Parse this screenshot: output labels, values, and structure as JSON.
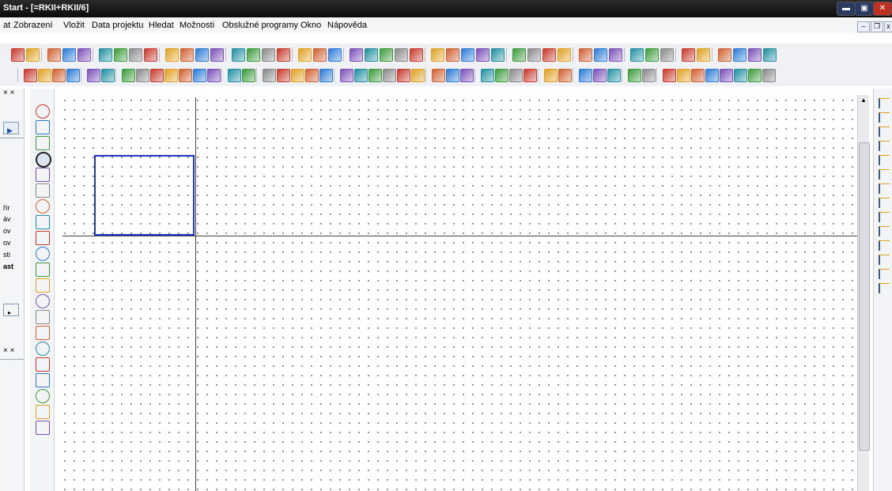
{
  "window": {
    "title": "Start - [=RKII+RKII/6]",
    "controls": [
      "minimize",
      "maximize",
      "close"
    ]
  },
  "menu": {
    "items": [
      {
        "label": "at"
      },
      {
        "label": "Zobrazení"
      },
      {
        "label": "Vložit"
      },
      {
        "label": "Data projektu"
      },
      {
        "label": "Hledat"
      },
      {
        "label": "Možnosti"
      },
      {
        "label": "Obslužné programy"
      },
      {
        "label": "Okno"
      },
      {
        "label": "Nápověda"
      }
    ]
  },
  "left_panel": {
    "labels": [
      "řír",
      "áv",
      "ov",
      "ov",
      "sti",
      "ast"
    ],
    "close1": "× ×",
    "close2": "× ×"
  },
  "drawing_tools": [
    "line-tool-icon",
    "polyline-tool-icon",
    "polygon-tool-icon",
    "rectangle-tool-icon",
    "circle-tool-icon",
    "ellipse-tool-icon",
    "arc-tool-icon",
    "curve-tool-icon",
    "clock-arc-tool-icon",
    "spiral-tool-icon",
    "connector-tool-icon",
    "text-tool-icon",
    "image-tool-icon",
    "globe-tool-icon",
    "dimension-tool-icon",
    "measure-tool-icon",
    "multi-dimension-tool-icon",
    "chain-dimension-tool-icon",
    "angle-dimension-tool-icon",
    "triangle-tool-icon",
    "rotate-tool-icon"
  ],
  "colors": {
    "selection": "#1a35c8",
    "titlebar": "#111111",
    "toolbar": "#f0f1f4"
  }
}
